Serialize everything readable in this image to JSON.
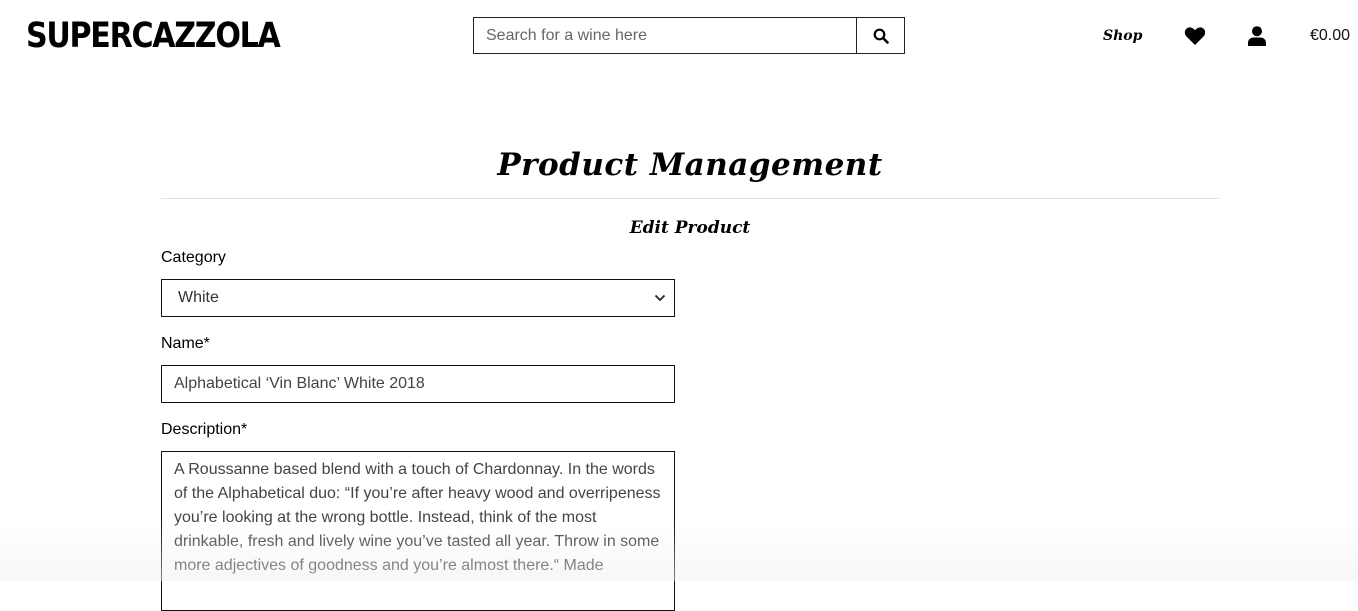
{
  "header": {
    "brand": "SUPERCAZZOLA",
    "search_placeholder": "Search for a wine here",
    "search_icon": "search-icon",
    "nav": {
      "shop_label": "Shop",
      "wishlist_icon": "heart-icon",
      "account_icon": "user-icon",
      "bag_total": "€0.00"
    }
  },
  "page": {
    "title": "Product Management",
    "subtitle": "Edit Product"
  },
  "form": {
    "category_label": "Category",
    "category_value": "White",
    "name_label": "Name*",
    "name_value": "Alphabetical ‘Vin Blanc’ White 2018",
    "description_label": "Description*",
    "description_value": "A Roussanne based blend with a touch of Chardonnay. In the words of the Alphabetical duo: “If you’re after heavy wood and overripeness you’re looking at the wrong bottle. Instead, think of the most drinkable, fresh and lively wine you’ve tasted all year. Throw in some more adjectives of goodness and you’re almost there.“ Made"
  }
}
